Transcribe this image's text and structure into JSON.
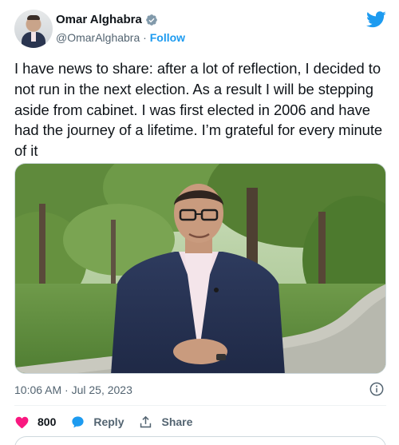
{
  "tweet": {
    "author_name": "Omar Alghabra",
    "handle": "@OmarAlghabra",
    "separator": " · ",
    "follow_label": "Follow",
    "text": "I have news to share: after a lot of reflection, I decided to not run in the next election. As a result I will be stepping aside from cabinet. I was first elected in 2006 and have had the journey of a lifetime. I’m grateful for every minute of it",
    "timestamp": "10:06 AM · Jul 25, 2023",
    "likes_count": "800",
    "reply_label": "Reply",
    "share_label": "Share"
  },
  "icons": {
    "verified": "verified-badge-icon",
    "brand": "twitter-bird-icon",
    "info": "info-icon",
    "like": "heart-icon",
    "reply": "reply-bubble-icon",
    "share": "share-icon"
  },
  "colors": {
    "brand_blue": "#1d9bf0",
    "like_red": "#f91880",
    "secondary_text": "#536471",
    "primary_text": "#0f1419"
  }
}
